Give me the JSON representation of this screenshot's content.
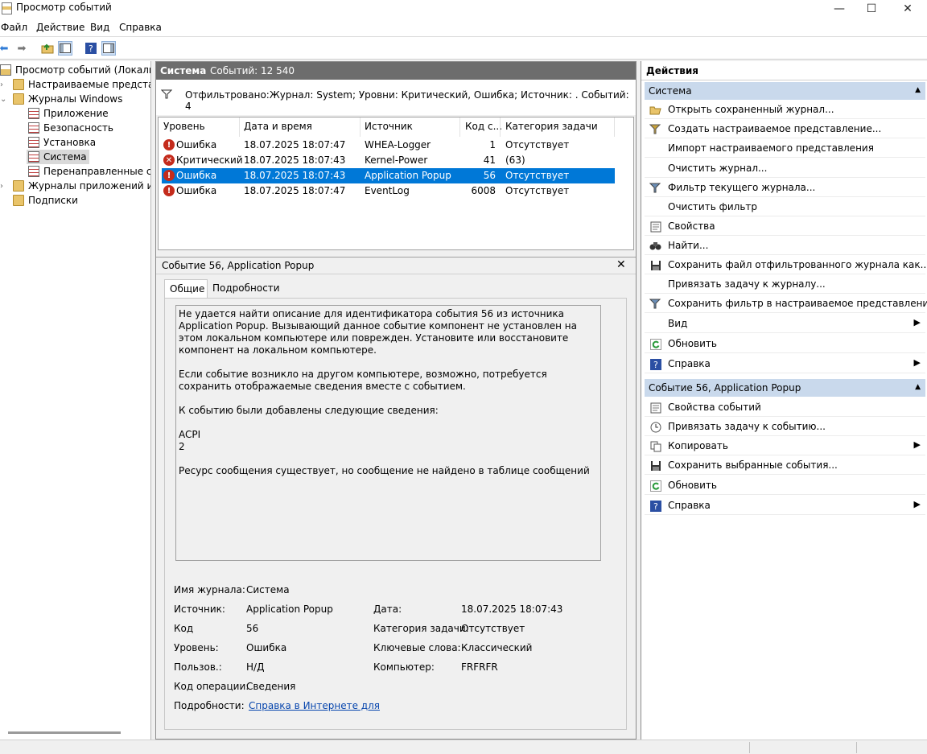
{
  "window": {
    "title": "Просмотр событий",
    "minimize": "—",
    "maximize": "☐",
    "close": "✕"
  },
  "menu": {
    "file": "Файл",
    "action": "Действие",
    "view": "Вид",
    "help": "Справка"
  },
  "tree": {
    "root": "Просмотр событий (Локальный)",
    "custom_views": "Настраиваемые представления",
    "windows_logs": "Журналы Windows",
    "application": "Приложение",
    "security": "Безопасность",
    "setup": "Установка",
    "system": "Система",
    "forwarded": "Перенаправленные события",
    "app_logs": "Журналы приложений и служб",
    "subscriptions": "Подписки"
  },
  "center": {
    "log_name": "Система",
    "event_count": "Событий: 12 540",
    "filter_text": "Отфильтровано:Журнал: System; Уровни: Критический, Ошибка; Источник: . Событий: 4",
    "columns": [
      "Уровень",
      "Дата и время",
      "Источник",
      "Код с...",
      "Категория задачи"
    ],
    "rows": [
      {
        "level": "Ошибка",
        "icon": "error-icon",
        "date": "18.07.2025 18:07:47",
        "source": "WHEA-Logger",
        "code": "1",
        "category": "Отсутствует"
      },
      {
        "level": "Критический",
        "icon": "critical-icon",
        "date": "18.07.2025 18:07:43",
        "source": "Kernel-Power",
        "code": "41",
        "category": "(63)"
      },
      {
        "level": "Ошибка",
        "icon": "error-icon",
        "date": "18.07.2025 18:07:43",
        "source": "Application Popup",
        "code": "56",
        "category": "Отсутствует"
      },
      {
        "level": "Ошибка",
        "icon": "error-icon",
        "date": "18.07.2025 18:07:47",
        "source": "EventLog",
        "code": "6008",
        "category": "Отсутствует"
      }
    ]
  },
  "detail": {
    "title": "Событие 56, Application Popup",
    "close": "✕",
    "tab_general": "Общие",
    "tab_details": "Подробности",
    "message_p1": "Не удается найти описание для идентификатора события 56 из источника Application Popup. Вызывающий данное событие компонент не установлен на этом локальном компьютере или поврежден. Установите или восстановите компонент на локальном компьютере.",
    "message_p2": "Если событие возникло на другом компьютере, возможно, потребуется сохранить отображаемые сведения вместе с событием.",
    "message_p3": "К событию были добавлены следующие сведения:",
    "message_p4a": "ACPI",
    "message_p4b": "2",
    "message_p5": "Ресурс сообщения существует, но сообщение не найдено в таблице сообщений",
    "lbl_log": "Имя журнала:",
    "val_log": "Система",
    "lbl_source": "Источник:",
    "val_source": "Application Popup",
    "lbl_date": "Дата:",
    "val_date": "18.07.2025 18:07:43",
    "lbl_code": "Код",
    "val_code": "56",
    "lbl_category": "Категория задачи:",
    "val_category": "Отсутствует",
    "lbl_level": "Уровень:",
    "val_level": "Ошибка",
    "lbl_keywords": "Ключевые слова:",
    "val_keywords": "Классический",
    "lbl_user": "Пользов.:",
    "val_user": "Н/Д",
    "lbl_computer": "Компьютер:",
    "val_computer": "FRFRFR",
    "lbl_opcode": "Код операции:",
    "val_opcode": "Сведения",
    "lbl_more": "Подробности:",
    "val_more": "Справка в Интернете для "
  },
  "actions": {
    "title": "Действия",
    "section1": "Система",
    "items1": [
      {
        "label": "Открыть сохраненный журнал...",
        "icon": "folder-open-icon"
      },
      {
        "label": "Создать настраиваемое представление...",
        "icon": "filter-create-icon"
      },
      {
        "label": "Импорт настраиваемого представления",
        "icon": ""
      },
      {
        "label": "Очистить журнал...",
        "icon": ""
      },
      {
        "label": "Фильтр текущего журнала...",
        "icon": "filter-icon"
      },
      {
        "label": "Очистить фильтр",
        "icon": ""
      },
      {
        "label": "Свойства",
        "icon": "properties-icon"
      },
      {
        "label": "Найти...",
        "icon": "binoculars-icon"
      },
      {
        "label": "Сохранить файл отфильтрованного журнала как...",
        "icon": "save-icon"
      },
      {
        "label": "Привязать задачу к журналу...",
        "icon": ""
      },
      {
        "label": "Сохранить фильтр в настраиваемое представление...",
        "icon": "filter-save-icon"
      },
      {
        "label": "Вид",
        "icon": ""
      },
      {
        "label": "Обновить",
        "icon": "refresh-icon"
      },
      {
        "label": "Справка",
        "icon": "help-icon"
      }
    ],
    "section2": "Событие 56, Application Popup",
    "items2": [
      {
        "label": "Свойства событий",
        "icon": "properties-icon"
      },
      {
        "label": "Привязать задачу к событию...",
        "icon": "task-icon"
      },
      {
        "label": "Копировать",
        "icon": "copy-icon"
      },
      {
        "label": "Сохранить выбранные события...",
        "icon": "save-icon"
      },
      {
        "label": "Обновить",
        "icon": "refresh-icon"
      },
      {
        "label": "Справка",
        "icon": "help-icon"
      }
    ]
  }
}
